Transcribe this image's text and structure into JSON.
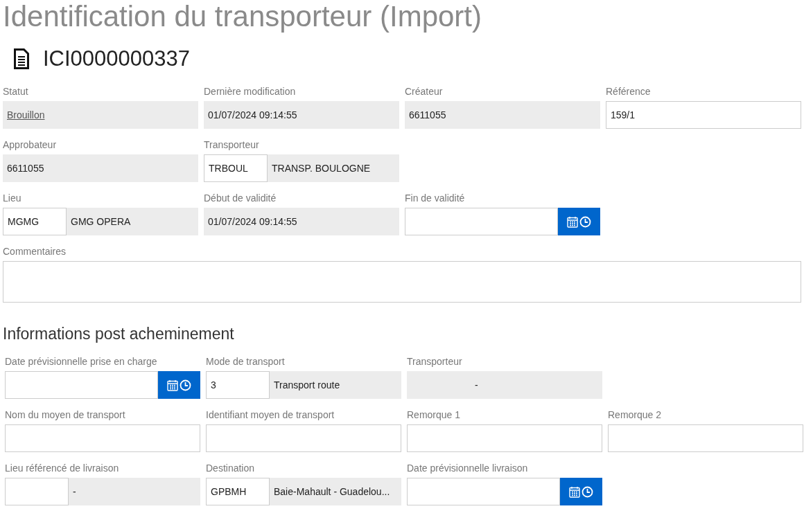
{
  "title": "Identification du transporteur (Import)",
  "document": {
    "number": "ICI0000000337"
  },
  "sections": [
    {
      "rows": [
        [
          {
            "kind": "link",
            "label": "Statut",
            "value": "Brouillon"
          },
          {
            "kind": "readonly",
            "label": "Dernière modification",
            "value": "01/07/2024 09:14:55"
          },
          {
            "kind": "readonly",
            "label": "Créateur",
            "value": "6611055"
          },
          {
            "kind": "input",
            "label": "Référence",
            "value": "159/1"
          }
        ],
        [
          {
            "kind": "readonly",
            "label": "Approbateur",
            "value": "6611055"
          },
          {
            "kind": "code",
            "label": "Transporteur",
            "code": "TRBOUL",
            "code_editable": true,
            "description": "TRANSP. BOULOGNE"
          }
        ],
        [
          {
            "kind": "code",
            "label": "Lieu",
            "code": "MGMG",
            "code_editable": true,
            "description": "GMG OPERA"
          },
          {
            "kind": "readonly",
            "label": "Début de validité",
            "value": "01/07/2024 09:14:55"
          },
          {
            "kind": "date",
            "label": "Fin de validité"
          }
        ],
        [
          {
            "kind": "textarea",
            "label": "Commentaires"
          }
        ]
      ]
    },
    {
      "heading": "Informations post acheminement",
      "rows": [
        [
          {
            "kind": "date",
            "label": "Date prévisionnelle prise en charge"
          },
          {
            "kind": "code",
            "label": "Mode de transport",
            "code": "3",
            "code_editable": true,
            "description": "Transport route"
          },
          {
            "kind": "code",
            "label": "Transporteur",
            "code_editable": false,
            "description": "-"
          }
        ],
        [
          {
            "kind": "input",
            "label": "Nom du moyen de transport"
          },
          {
            "kind": "input",
            "label": "Identifiant moyen de transport"
          },
          {
            "kind": "input",
            "label": "Remorque 1"
          },
          {
            "kind": "input",
            "label": "Remorque 2"
          }
        ],
        [
          {
            "kind": "code",
            "label": "Lieu référencé de livraison",
            "code_editable": true,
            "description": "-"
          },
          {
            "kind": "code",
            "label": "Destination",
            "code": "GPBMH",
            "code_editable": true,
            "description": "Baie-Mahault - Guadelou..."
          },
          {
            "kind": "date",
            "label": "Date prévisionnelle livraison"
          }
        ]
      ]
    }
  ]
}
